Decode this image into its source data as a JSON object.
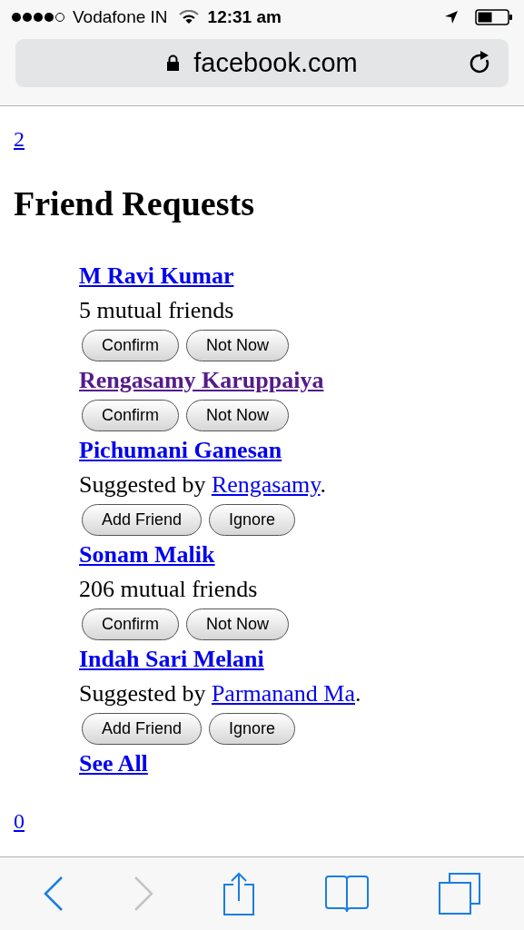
{
  "status_bar": {
    "carrier": "Vodafone IN",
    "time": "12:31 am"
  },
  "address_bar": {
    "domain": "facebook.com"
  },
  "top_link": "2",
  "heading": "Friend Requests",
  "requests": [
    {
      "name": "M Ravi Kumar",
      "visited": false,
      "detail": {
        "kind": "mutual",
        "text": "5 mutual friends"
      },
      "buttons": [
        "Confirm",
        "Not Now"
      ]
    },
    {
      "name": "Rengasamy Karuppaiya",
      "visited": true,
      "buttons": [
        "Confirm",
        "Not Now"
      ]
    },
    {
      "name": "Pichumani Ganesan",
      "visited": false,
      "detail": {
        "kind": "suggested",
        "prefix": "Suggested by",
        "link": "Rengasamy",
        "suffix": "."
      },
      "buttons": [
        "Add Friend",
        "Ignore"
      ]
    },
    {
      "name": "Sonam Malik",
      "visited": false,
      "detail": {
        "kind": "mutual",
        "text": "206 mutual friends"
      },
      "buttons": [
        "Confirm",
        "Not Now"
      ]
    },
    {
      "name": "Indah Sari Melani",
      "visited": false,
      "detail": {
        "kind": "suggested",
        "prefix": "Suggested by",
        "link": "Parmanand Ma",
        "suffix": "."
      },
      "buttons": [
        "Add Friend",
        "Ignore"
      ]
    }
  ],
  "see_all": "See All",
  "bottom_link": "0",
  "toolbar": {
    "back_enabled": true,
    "forward_enabled": false
  }
}
